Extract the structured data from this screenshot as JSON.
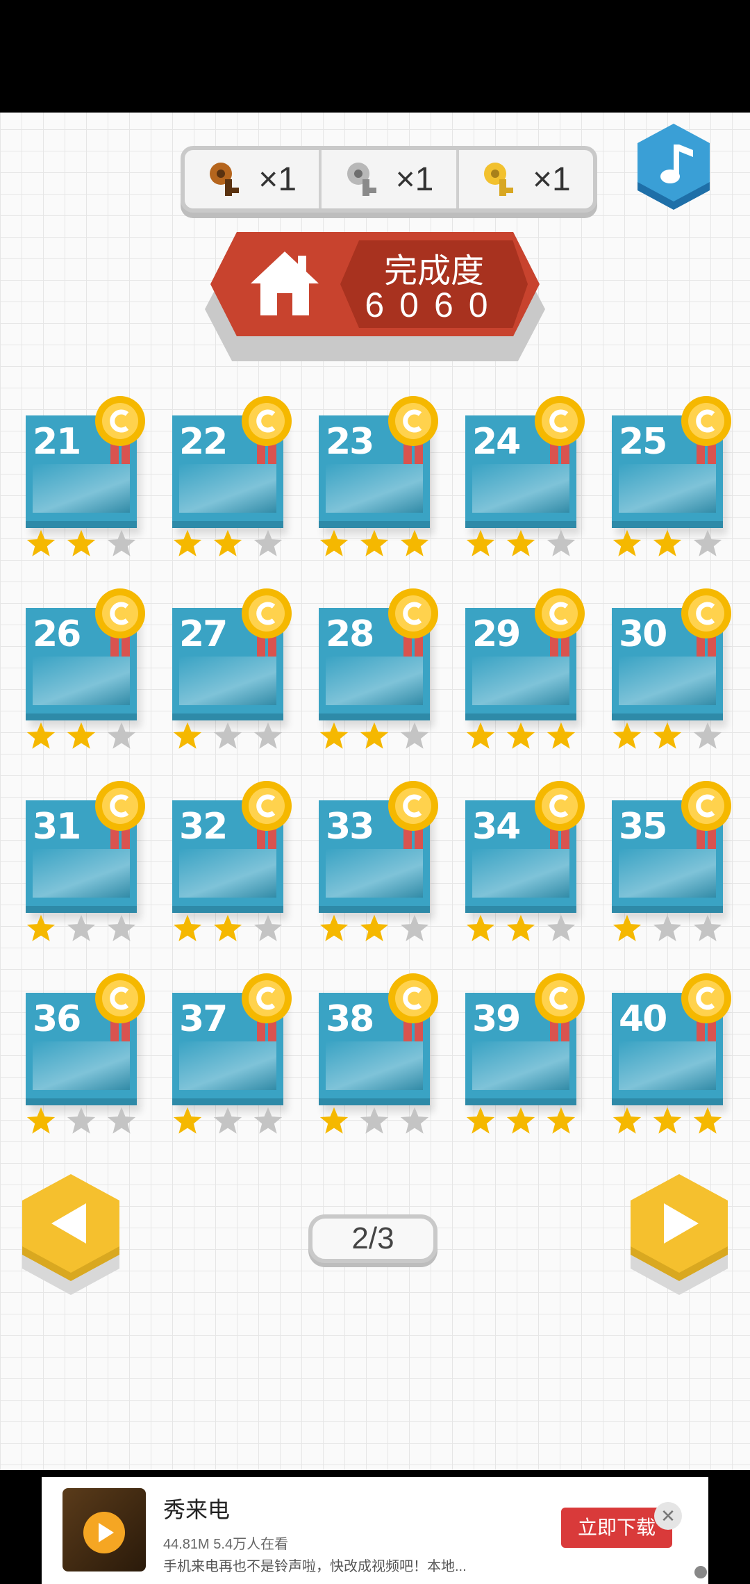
{
  "keys": [
    {
      "name": "bronze",
      "color": "#b5651d",
      "dark": "#5a3210",
      "count": "×1"
    },
    {
      "name": "silver",
      "color": "#b8b8b8",
      "dark": "#6e6e6e",
      "count": "×1"
    },
    {
      "name": "gold",
      "color": "#f2c12e",
      "dark": "#a8801a",
      "count": "×1"
    }
  ],
  "music_icon": "music-note-icon",
  "banner": {
    "label": "完成度",
    "value": "6060",
    "icon": "home-icon"
  },
  "colors": {
    "card": "#3aa3c4",
    "star_on": "#f5b800",
    "star_off": "#c4c4c4",
    "medal": "#f5b800",
    "ribbon": "#d9534f",
    "nav": "#f5c02e"
  },
  "levels": [
    {
      "num": "21",
      "stars": 2
    },
    {
      "num": "22",
      "stars": 2
    },
    {
      "num": "23",
      "stars": 3
    },
    {
      "num": "24",
      "stars": 2
    },
    {
      "num": "25",
      "stars": 2
    },
    {
      "num": "26",
      "stars": 2
    },
    {
      "num": "27",
      "stars": 1
    },
    {
      "num": "28",
      "stars": 2
    },
    {
      "num": "29",
      "stars": 3
    },
    {
      "num": "30",
      "stars": 2
    },
    {
      "num": "31",
      "stars": 1
    },
    {
      "num": "32",
      "stars": 2
    },
    {
      "num": "33",
      "stars": 2
    },
    {
      "num": "34",
      "stars": 2
    },
    {
      "num": "35",
      "stars": 1
    },
    {
      "num": "36",
      "stars": 1
    },
    {
      "num": "37",
      "stars": 1
    },
    {
      "num": "38",
      "stars": 1
    },
    {
      "num": "39",
      "stars": 3
    },
    {
      "num": "40",
      "stars": 3
    }
  ],
  "pagination": {
    "indicator": "2/3"
  },
  "ad": {
    "title": "秀来电",
    "meta": "44.81M 5.4万人在看",
    "description": "手机来电再也不是铃声啦，快改成视频吧！本地...",
    "button": "立即下载",
    "close": "✕"
  }
}
